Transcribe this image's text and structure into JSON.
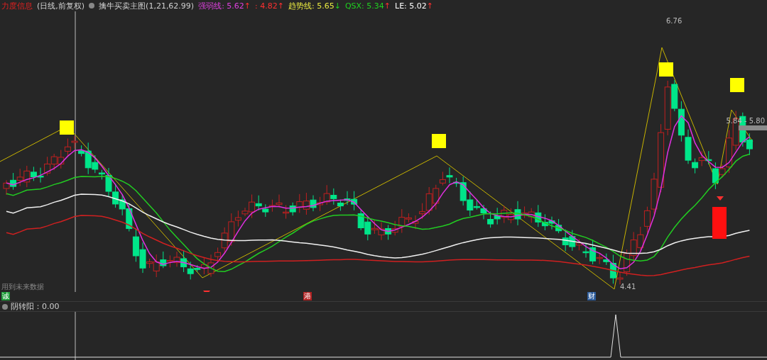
{
  "header": {
    "title": "力度信息",
    "period": "(日线,前复权)",
    "indicator_name": "擒牛买卖主图(1,21,62.99)",
    "readings": [
      {
        "label": "强弱线:",
        "value": "5.62",
        "arrow": "↑",
        "kind": "up",
        "color": "#e040e0"
      },
      {
        "value": ": 4.82",
        "arrow": "↑",
        "kind": "up",
        "color": "#ff3030"
      },
      {
        "label": "趋势线:",
        "value": "5.65",
        "arrow": "↓",
        "kind": "down",
        "color": "#e8e840"
      },
      {
        "label": "QSX:",
        "value": "5.34",
        "arrow": "↑",
        "kind": "up",
        "color": "#20d020"
      },
      {
        "label": "LE:",
        "value": "5.02",
        "arrow": "↑",
        "kind": "up",
        "color": "#ffffff"
      }
    ]
  },
  "main_chart": {
    "high_label": "6.76",
    "low_label": "4.41",
    "range_label": "5.84 - 5.80",
    "note": "用到未来数据"
  },
  "badges": [
    {
      "text": "诚",
      "color": "#1e9e3a"
    },
    {
      "text": "港",
      "color": "#b02020"
    },
    {
      "text": "财",
      "color": "#2a5a9a"
    }
  ],
  "lower_panel": {
    "indicator": "阴转阳：0.00"
  }
}
